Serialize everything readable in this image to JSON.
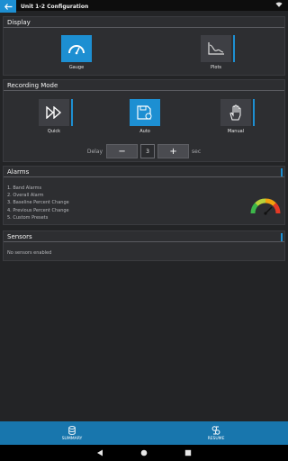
{
  "header": {
    "title": "Unit 1-2 Configuration"
  },
  "display": {
    "title": "Display",
    "options": [
      {
        "label": "Gauge",
        "icon": "gauge-icon",
        "selected": true
      },
      {
        "label": "Plots",
        "icon": "plot-icon",
        "selected": false
      }
    ]
  },
  "recording": {
    "title": "Recording Mode",
    "options": [
      {
        "label": "Quick",
        "icon": "fast-forward-icon",
        "selected": false
      },
      {
        "label": "Auto",
        "icon": "floppy-disk-icon",
        "selected": true
      },
      {
        "label": "Manual",
        "icon": "hand-icon",
        "selected": false
      }
    ],
    "delay_label": "Delay",
    "delay_value": "3",
    "minus": "−",
    "plus": "+",
    "unit": "sec"
  },
  "alarms": {
    "title": "Alarms",
    "items": [
      "1. Band Alarms",
      "2. Overall Alarm",
      "3. Baseline Percent Change",
      "4. Previous Percent Change",
      "5. Custom Presets"
    ]
  },
  "sensors": {
    "title": "Sensors",
    "message": "No sensors enabled"
  },
  "nav": {
    "summary": "SUMMARY",
    "resume": "RESUME"
  },
  "colors": {
    "accent": "#1d8fd2",
    "nav": "#1876ad"
  }
}
